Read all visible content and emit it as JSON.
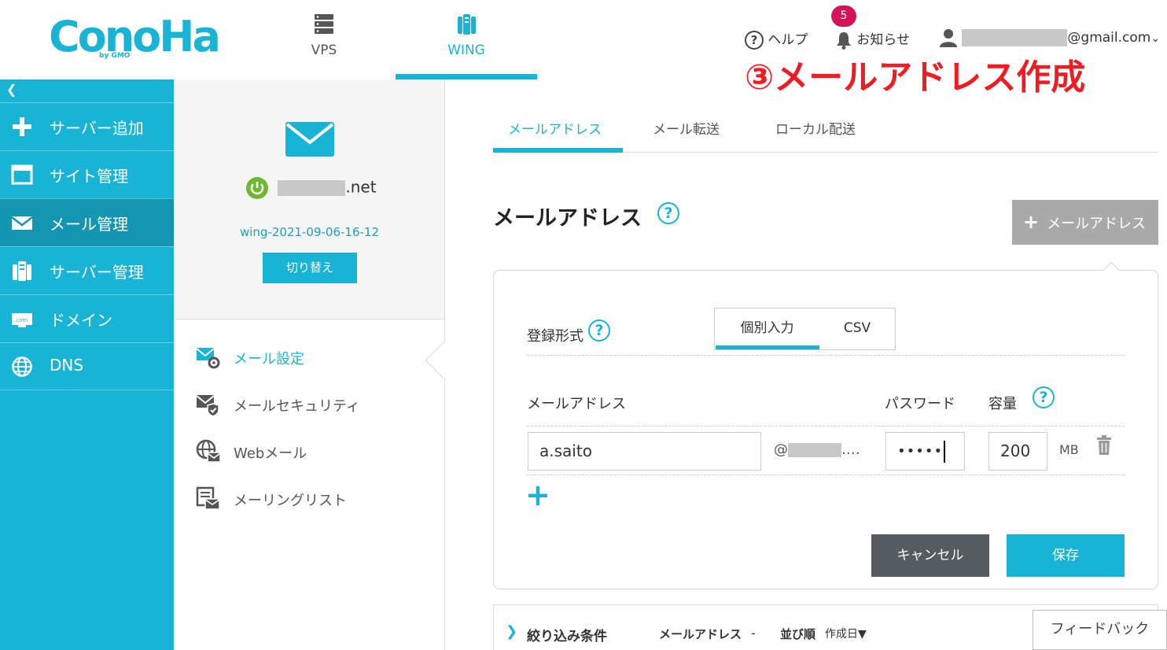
{
  "header": {
    "logo": "ConoHa",
    "logo_sub": "by GMO",
    "nav": [
      {
        "label": "VPS",
        "icon": "server-icon",
        "active": false
      },
      {
        "label": "WING",
        "icon": "wing-icon",
        "active": true
      }
    ],
    "help": "ヘルプ",
    "notifications": "お知らせ",
    "notification_count": "5",
    "account_suffix": "@gmail.com"
  },
  "annotation": "③メールアドレス作成",
  "sidebar": {
    "collapse": "❮",
    "items": [
      {
        "label": "サーバー追加",
        "icon": "plus-icon"
      },
      {
        "label": "サイト管理",
        "icon": "site-icon"
      },
      {
        "label": "メール管理",
        "icon": "mail-icon",
        "active": true
      },
      {
        "label": "サーバー管理",
        "icon": "server-manage-icon"
      },
      {
        "label": "ドメイン",
        "icon": "domain-icon"
      },
      {
        "label": "DNS",
        "icon": "globe-icon"
      }
    ]
  },
  "server_panel": {
    "domain_suffix": ".net",
    "wing_id": "wing-2021-09-06-16-12",
    "switch_label": "切り替え"
  },
  "mail_menu": [
    {
      "label": "メール設定",
      "icon": "mail-settings-icon",
      "active": true
    },
    {
      "label": "メールセキュリティ",
      "icon": "mail-security-icon"
    },
    {
      "label": "Webメール",
      "icon": "webmail-icon"
    },
    {
      "label": "メーリングリスト",
      "icon": "mailing-list-icon"
    }
  ],
  "tabs": [
    {
      "label": "メールアドレス",
      "active": true
    },
    {
      "label": "メール転送"
    },
    {
      "label": "ローカル配送"
    }
  ],
  "page_title": "メールアドレス",
  "add_button": "メールアドレス",
  "form": {
    "registration_label": "登録形式",
    "mode_options": [
      "個別入力",
      "CSV"
    ],
    "selected_mode": "個別入力",
    "col_email": "メールアドレス",
    "col_password": "パスワード",
    "col_capacity": "容量",
    "email_value": "a.saito",
    "at_domain": "@",
    "at_domain_tail": ".…",
    "password_value": "•••••",
    "capacity_value": "200",
    "capacity_unit": "MB",
    "cancel": "キャンセル",
    "save": "保存"
  },
  "filter": {
    "toggle": "❯",
    "label": "絞り込み条件",
    "email_label": "メールアドレス",
    "email_value": "-",
    "order_label": "並び順",
    "order_value": "作成日▼"
  },
  "feedback": "フィードバック",
  "colors": {
    "brand": "#19b4d5",
    "sidebar_active": "#1496b2",
    "annotation": "#ee1d23",
    "badge": "#d4145a",
    "cancel": "#555b5e"
  }
}
